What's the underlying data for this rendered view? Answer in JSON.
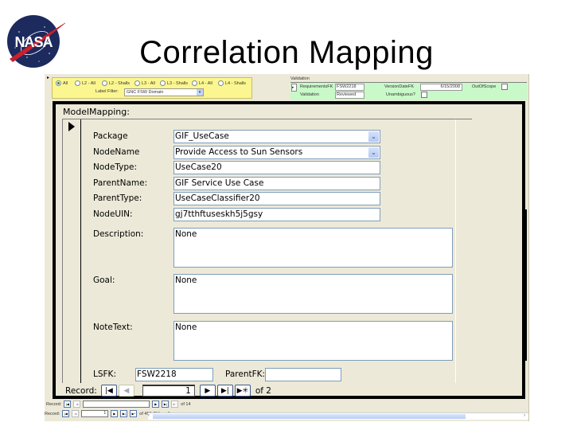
{
  "slide": {
    "title": "Correlation Mapping",
    "logo": "nasa-meatball-logo"
  },
  "background_form": {
    "filter_options": [
      {
        "label": "All",
        "selected": true
      },
      {
        "label": "L2 - All",
        "selected": false
      },
      {
        "label": "L2 - Shalls",
        "selected": false
      },
      {
        "label": "L3 - All",
        "selected": false
      },
      {
        "label": "L3 - Shalls",
        "selected": false
      },
      {
        "label": "L4 - All",
        "selected": false
      },
      {
        "label": "L4 - Shalls",
        "selected": false
      }
    ],
    "label_filter_label": "Label Filter:",
    "label_filter_value": "GNC FSW Domain",
    "validation_title": "Validation",
    "validation": {
      "requirement_fk_label": "RequirementsFK",
      "requirement_fk_value": "FSW2218",
      "version_date_fk_label": "VersionDateFK",
      "version_date_fk_value": "6/15/2008",
      "out_of_scope_label": "OutOfScope",
      "validation_label": "Validation",
      "validation_value": "Reviewed",
      "unambiguous_label": "Unambiguous?"
    },
    "subform_nav": {
      "record_label": "Record:",
      "of_label": "of 14"
    },
    "main_nav": {
      "record_label": "Record:",
      "current": "1",
      "of_label": "of 456 (Filtered)"
    }
  },
  "model_mapping": {
    "title": "ModelMapping:",
    "fields": [
      {
        "label": "Package",
        "value": "GIF_UseCase",
        "type": "combo"
      },
      {
        "label": "NodeName",
        "value": "Provide Access to Sun Sensors",
        "type": "combo"
      },
      {
        "label": "NodeType:",
        "value": "UseCase20",
        "type": "text"
      },
      {
        "label": "ParentName:",
        "value": "GIF Service Use Case",
        "type": "text"
      },
      {
        "label": "ParentType:",
        "value": "UseCaseClassifier20",
        "type": "text"
      },
      {
        "label": "NodeUIN:",
        "value": "gj7tthftuseskh5j5gsy",
        "type": "text"
      }
    ],
    "memos": [
      {
        "label": "Description:",
        "value": "None"
      },
      {
        "label": "Goal:",
        "value": "None"
      },
      {
        "label": "NoteText:",
        "value": "None"
      }
    ],
    "lsfk_label": "LSFK:",
    "lsfk_value": "FSW2218",
    "parentfk_label": "ParentFK:",
    "parentfk_value": "",
    "record_nav": {
      "record_label": "Record:",
      "current": "1",
      "of_label": "of  2"
    }
  },
  "icons": {
    "first": "⏮",
    "prev": "◀",
    "next": "▶",
    "last": "⏭",
    "new": "▶✳",
    "dropdown": "⌄"
  }
}
